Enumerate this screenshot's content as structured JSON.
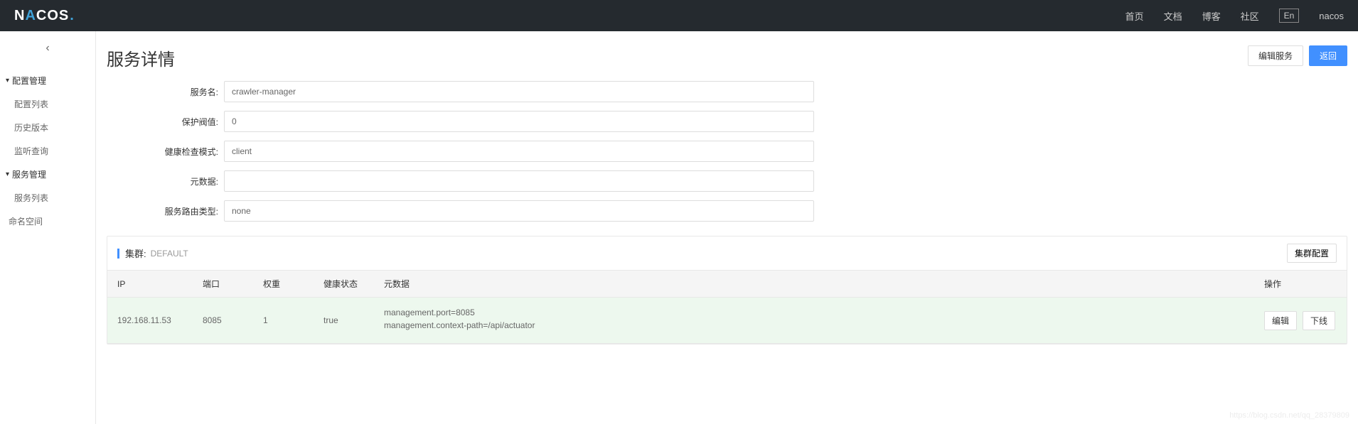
{
  "header": {
    "logo_part1": "N",
    "logo_part2": "A",
    "logo_part3": "COS",
    "nav": [
      "首页",
      "文档",
      "博客",
      "社区"
    ],
    "lang": "En",
    "user": "nacos"
  },
  "sidebar": {
    "groups": [
      {
        "label": "配置管理",
        "items": [
          "配置列表",
          "历史版本",
          "监听查询"
        ]
      },
      {
        "label": "服务管理",
        "items": [
          "服务列表"
        ]
      }
    ],
    "namespace": "命名空间"
  },
  "page": {
    "title": "服务详情",
    "edit_service_btn": "编辑服务",
    "back_btn": "返回"
  },
  "form": {
    "service_name_label": "服务名:",
    "service_name_value": "crawler-manager",
    "threshold_label": "保护阀值:",
    "threshold_value": "0",
    "health_mode_label": "健康检查模式:",
    "health_mode_value": "client",
    "metadata_label": "元数据:",
    "metadata_value": "",
    "route_type_label": "服务路由类型:",
    "route_type_value": "none"
  },
  "cluster": {
    "title": "集群:",
    "name": "DEFAULT",
    "config_btn": "集群配置",
    "columns": {
      "ip": "IP",
      "port": "端口",
      "weight": "权重",
      "health": "健康状态",
      "metadata": "元数据",
      "action": "操作"
    },
    "row": {
      "ip": "192.168.11.53",
      "port": "8085",
      "weight": "1",
      "health": "true",
      "metadata_line1": "management.port=8085",
      "metadata_line2": "management.context-path=/api/actuator",
      "edit_btn": "编辑",
      "offline_btn": "下线"
    }
  },
  "watermark": "https://blog.csdn.net/qq_28379809"
}
